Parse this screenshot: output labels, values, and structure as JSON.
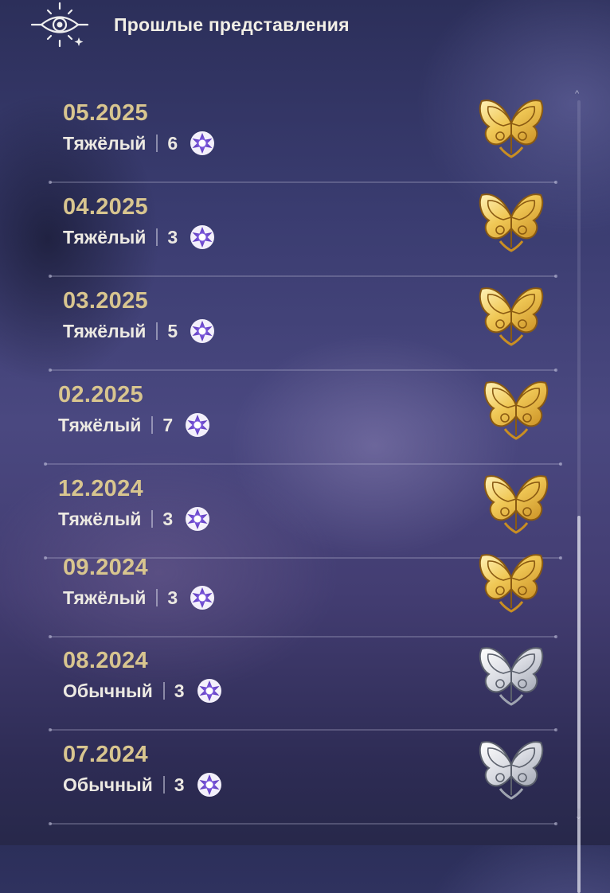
{
  "header": {
    "title": "Прошлые представления",
    "logo_icon": "eye-star-emblem-icon"
  },
  "records": [
    {
      "date": "05.2025",
      "difficulty": "Тяжёлый",
      "count": "6",
      "medal": "gold"
    },
    {
      "date": "04.2025",
      "difficulty": "Тяжёлый",
      "count": "3",
      "medal": "gold"
    },
    {
      "date": "03.2025",
      "difficulty": "Тяжёлый",
      "count": "5",
      "medal": "gold"
    },
    {
      "date": "02.2025",
      "difficulty": "Тяжёлый",
      "count": "7",
      "medal": "gold"
    },
    {
      "date": "12.2024",
      "difficulty": "Тяжёлый",
      "count": "3",
      "medal": "gold"
    },
    {
      "date": "09.2024",
      "difficulty": "Тяжёлый",
      "count": "3",
      "medal": "gold"
    },
    {
      "date": "08.2024",
      "difficulty": "Обычный",
      "count": "3",
      "medal": "silver"
    },
    {
      "date": "07.2024",
      "difficulty": "Обычный",
      "count": "3",
      "medal": "silver"
    }
  ],
  "icons": {
    "star": "purple-star-flower-icon",
    "medal": "butterfly-medal-icon"
  },
  "colors": {
    "date": "#d8c58f",
    "gold": "#e9c35a",
    "silver": "#d6d8de",
    "star": "#6b4bc4"
  }
}
